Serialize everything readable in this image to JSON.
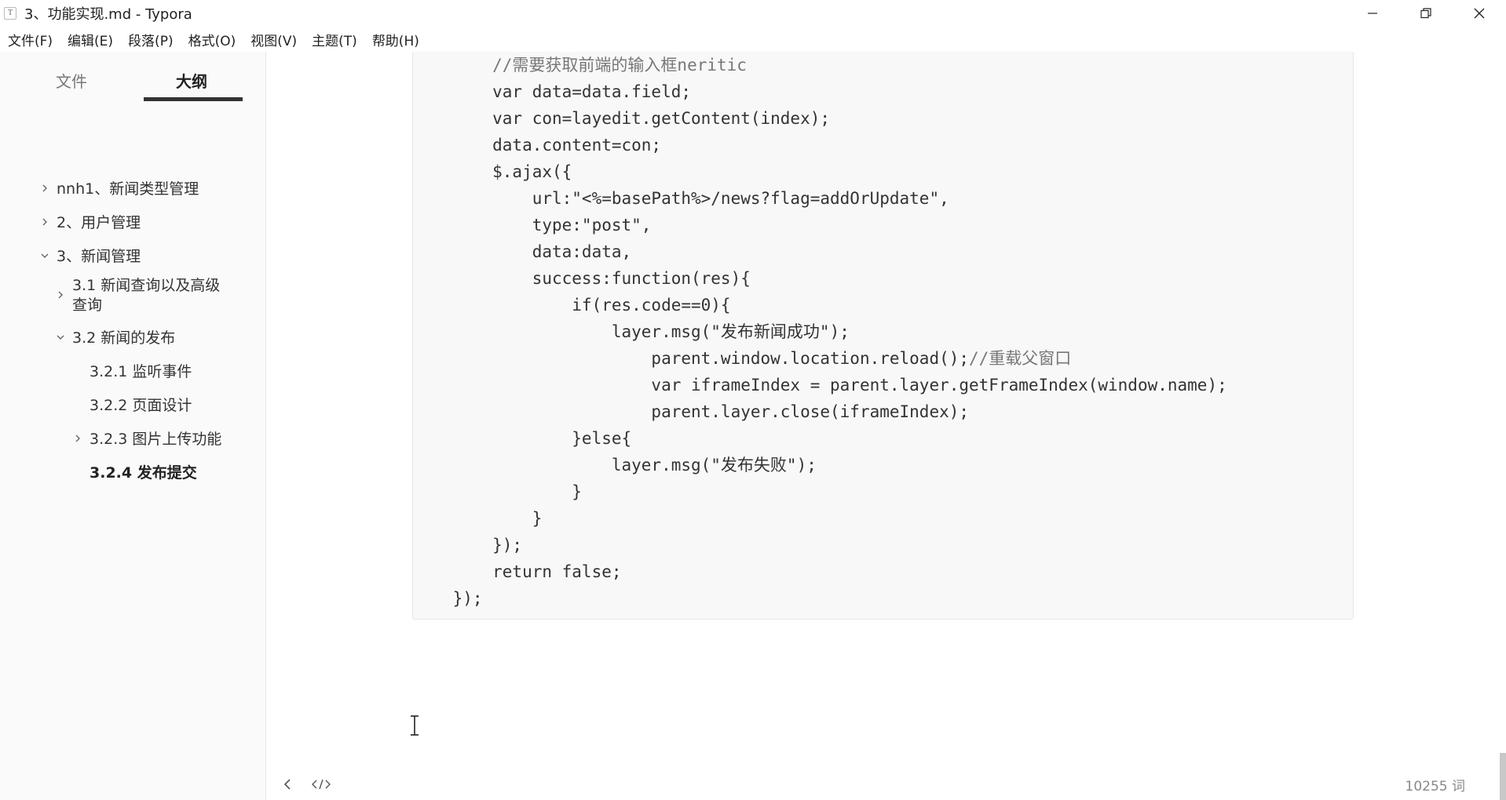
{
  "window": {
    "title": "3、功能实现.md - Typora",
    "app_icon_glyph": "T"
  },
  "menu": [
    "文件(F)",
    "编辑(E)",
    "段落(P)",
    "格式(O)",
    "视图(V)",
    "主题(T)",
    "帮助(H)"
  ],
  "sidebar": {
    "tab_files": "文件",
    "tab_outline": "大纲",
    "outline": [
      {
        "label": "nnh1、新闻类型管理",
        "chevron": "right",
        "active": false
      },
      {
        "label": "2、用户管理",
        "chevron": "right",
        "active": false
      },
      {
        "label": "3、新闻管理",
        "chevron": "down",
        "active": false
      },
      {
        "label": "3.1 新闻查询以及高级",
        "label2": "查询",
        "chevron": "right",
        "active": false
      },
      {
        "label": "3.2 新闻的发布",
        "chevron": "down",
        "active": false
      },
      {
        "label": "3.2.1 监听事件",
        "chevron": "none",
        "active": false
      },
      {
        "label": "3.2.2 页面设计",
        "chevron": "none",
        "active": false
      },
      {
        "label": "3.2.3 图片上传功能",
        "chevron": "right",
        "active": false
      },
      {
        "label": "3.2.4 发布提交",
        "chevron": "none",
        "active": true
      }
    ]
  },
  "code": {
    "lines": [
      {
        "code": "        //需要获取前端的输入框neritic",
        "comment": true
      },
      {
        "code": "        var data=data.field;"
      },
      {
        "code": "        var con=layedit.getContent(index);"
      },
      {
        "code": "        data.content=con;"
      },
      {
        "code": "        $.ajax({"
      },
      {
        "code": "            url:\"<%=basePath%>/news?flag=addOrUpdate\","
      },
      {
        "code": "            type:\"post\","
      },
      {
        "code": "            data:data,"
      },
      {
        "code": "            success:function(res){"
      },
      {
        "code": "                if(res.code==0){"
      },
      {
        "code": "                    layer.msg(\"发布新闻成功\");"
      },
      {
        "code": "                        parent.window.location.reload();",
        "trail_comment": "//重载父窗口"
      },
      {
        "code": "                        var iframeIndex = parent.layer.getFrameIndex(window.name);"
      },
      {
        "code": "                        parent.layer.close(iframeIndex);"
      },
      {
        "code": "                }else{"
      },
      {
        "code": "                    layer.msg(\"发布失败\");"
      },
      {
        "code": "                }"
      },
      {
        "code": "            }"
      },
      {
        "code": "        });"
      },
      {
        "code": "        return false;"
      },
      {
        "code": "    });"
      }
    ]
  },
  "status": {
    "word_count": "10255 词"
  }
}
